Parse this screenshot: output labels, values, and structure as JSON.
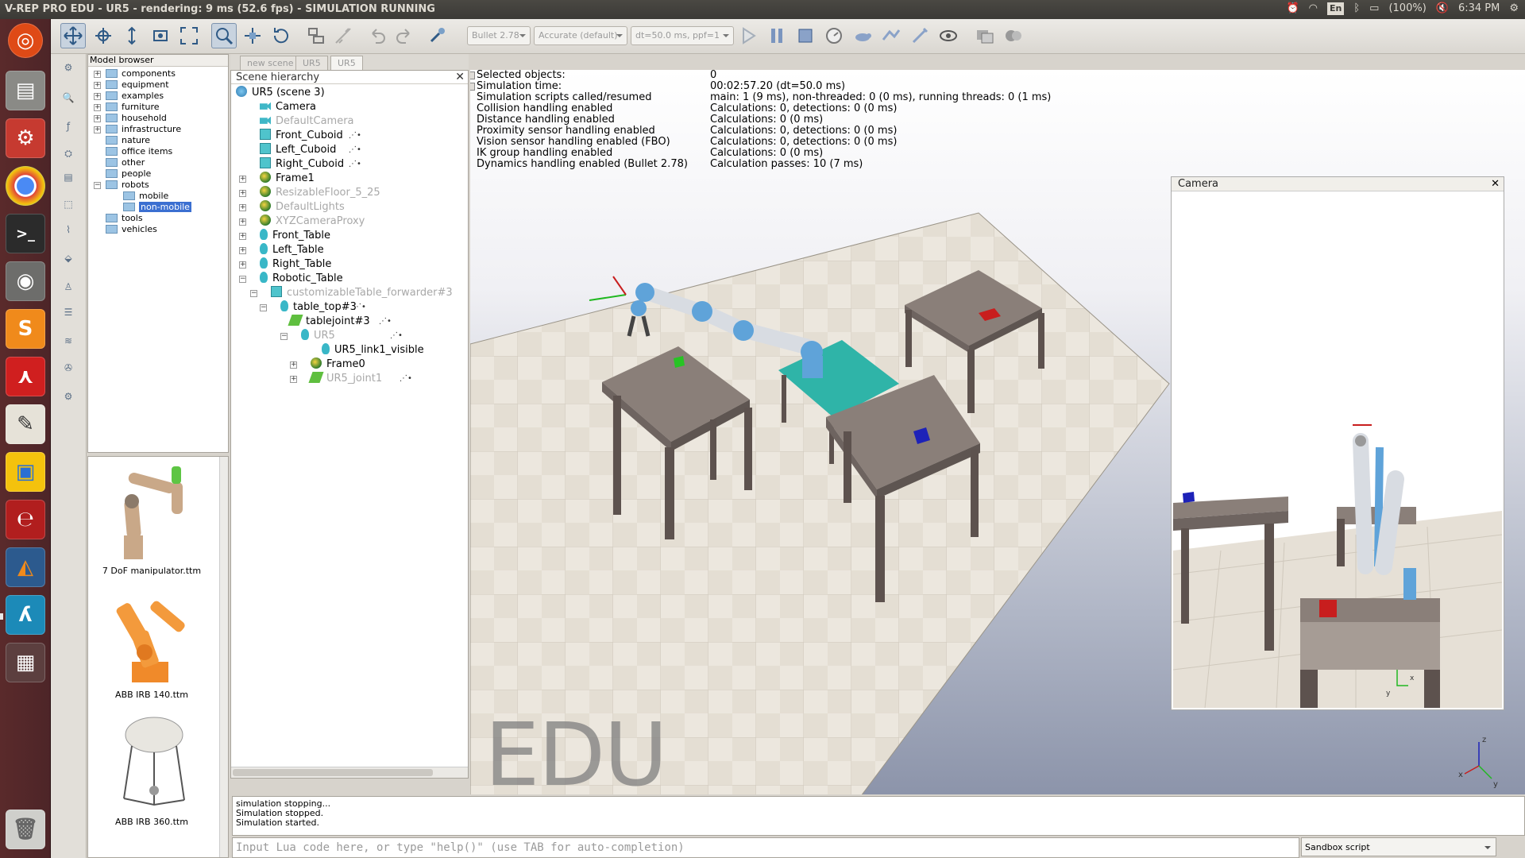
{
  "window_title": "V-REP PRO EDU - UR5 - rendering: 9 ms (52.6 fps) - SIMULATION RUNNING",
  "tray": {
    "keyboard": "En",
    "battery": "(100%)",
    "time": "6:34 PM"
  },
  "toolbar": {
    "engine": "Bullet 2.78",
    "accuracy": "Accurate (default)",
    "timestep": "dt=50.0 ms, ppf=1"
  },
  "model_browser": {
    "title": "Model browser",
    "folders": [
      "components",
      "equipment",
      "examples",
      "furniture",
      "household",
      "infrastructure",
      "nature",
      "office items",
      "other",
      "people",
      "robots",
      "mobile",
      "non-mobile",
      "tools",
      "vehicles"
    ],
    "selected": "non-mobile",
    "thumbnails": [
      "7 DoF manipulator.ttm",
      "ABB IRB 140.ttm",
      "ABB IRB 360.ttm"
    ]
  },
  "tabs": [
    "new scene",
    "UR5",
    "UR5"
  ],
  "hierarchy": {
    "title": "Scene hierarchy",
    "root": "UR5 (scene 3)",
    "items": [
      "Camera",
      "DefaultCamera",
      "Front_Cuboid",
      "Left_Cuboid",
      "Right_Cuboid",
      "Frame1",
      "ResizableFloor_5_25",
      "DefaultLights",
      "XYZCameraProxy",
      "Front_Table",
      "Left_Table",
      "Right_Table",
      "Robotic_Table",
      "customizableTable_forwarder#3",
      "table_top#3",
      "tablejoint#3",
      "UR5",
      "UR5_link1_visible",
      "Frame0",
      "UR5_joint1"
    ]
  },
  "info": [
    {
      "k": "Selected objects:",
      "v": "0"
    },
    {
      "k": "Simulation time:",
      "v": "00:02:57.20 (dt=50.0 ms)"
    },
    {
      "k": "Simulation scripts called/resumed",
      "v": "main: 1 (9 ms), non-threaded: 0 (0 ms), running threads: 0 (1 ms)"
    },
    {
      "k": "Collision handling enabled",
      "v": "Calculations: 0, detections: 0 (0 ms)"
    },
    {
      "k": "Distance handling enabled",
      "v": "Calculations: 0 (0 ms)"
    },
    {
      "k": "Proximity sensor handling enabled",
      "v": "Calculations: 0, detections: 0 (0 ms)"
    },
    {
      "k": "Vision sensor handling enabled (FBO)",
      "v": "Calculations: 0, detections: 0 (0 ms)"
    },
    {
      "k": "IK group handling enabled",
      "v": "Calculations: 0 (0 ms)"
    },
    {
      "k": "Dynamics handling enabled (Bullet 2.78)",
      "v": "Calculation passes: 10 (7 ms)"
    }
  ],
  "camera_window": {
    "title": "Camera"
  },
  "watermark": "EDU",
  "console": [
    "simulation stopping...",
    "Simulation stopped.",
    "Simulation started."
  ],
  "lua_input": {
    "placeholder": "Input Lua code here, or type \"help()\" (use TAB for auto-completion)"
  },
  "script_select": "Sandbox script",
  "colors": {
    "accent": "#3b6fd1",
    "floor": "#e7e1d6",
    "table": "#8a7f79",
    "pad": "#2fb4a8"
  }
}
